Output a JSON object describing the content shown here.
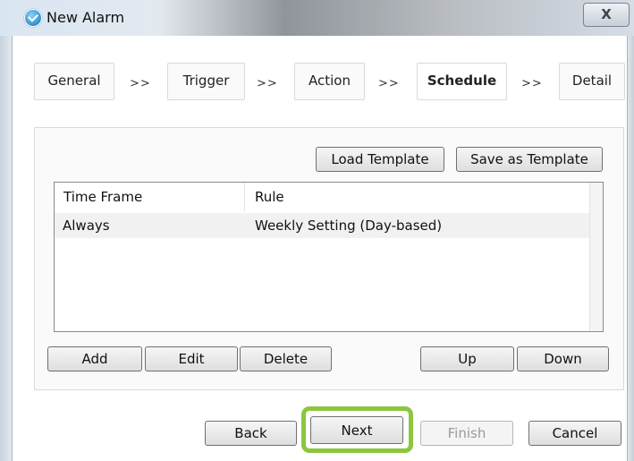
{
  "window": {
    "title": "New Alarm",
    "close_label": "X"
  },
  "steps": [
    {
      "label": "General"
    },
    {
      "label": "Trigger"
    },
    {
      "label": "Action"
    },
    {
      "label": "Schedule"
    },
    {
      "label": "Detail"
    }
  ],
  "step_separator": ">>",
  "template_buttons": {
    "load": "Load Template",
    "save": "Save as Template"
  },
  "table": {
    "headers": [
      "Time Frame",
      "Rule"
    ],
    "rows": [
      {
        "time_frame": "Always",
        "rule": "Weekly Setting (Day-based)"
      }
    ]
  },
  "list_buttons": {
    "add": "Add",
    "edit": "Edit",
    "delete": "Delete",
    "up": "Up",
    "down": "Down"
  },
  "nav_buttons": {
    "back": "Back",
    "next": "Next",
    "finish": "Finish",
    "cancel": "Cancel"
  },
  "colors": {
    "highlight": "#8cc63f",
    "active_step_text": "#000000",
    "disabled_text": "#9a9a9a"
  }
}
